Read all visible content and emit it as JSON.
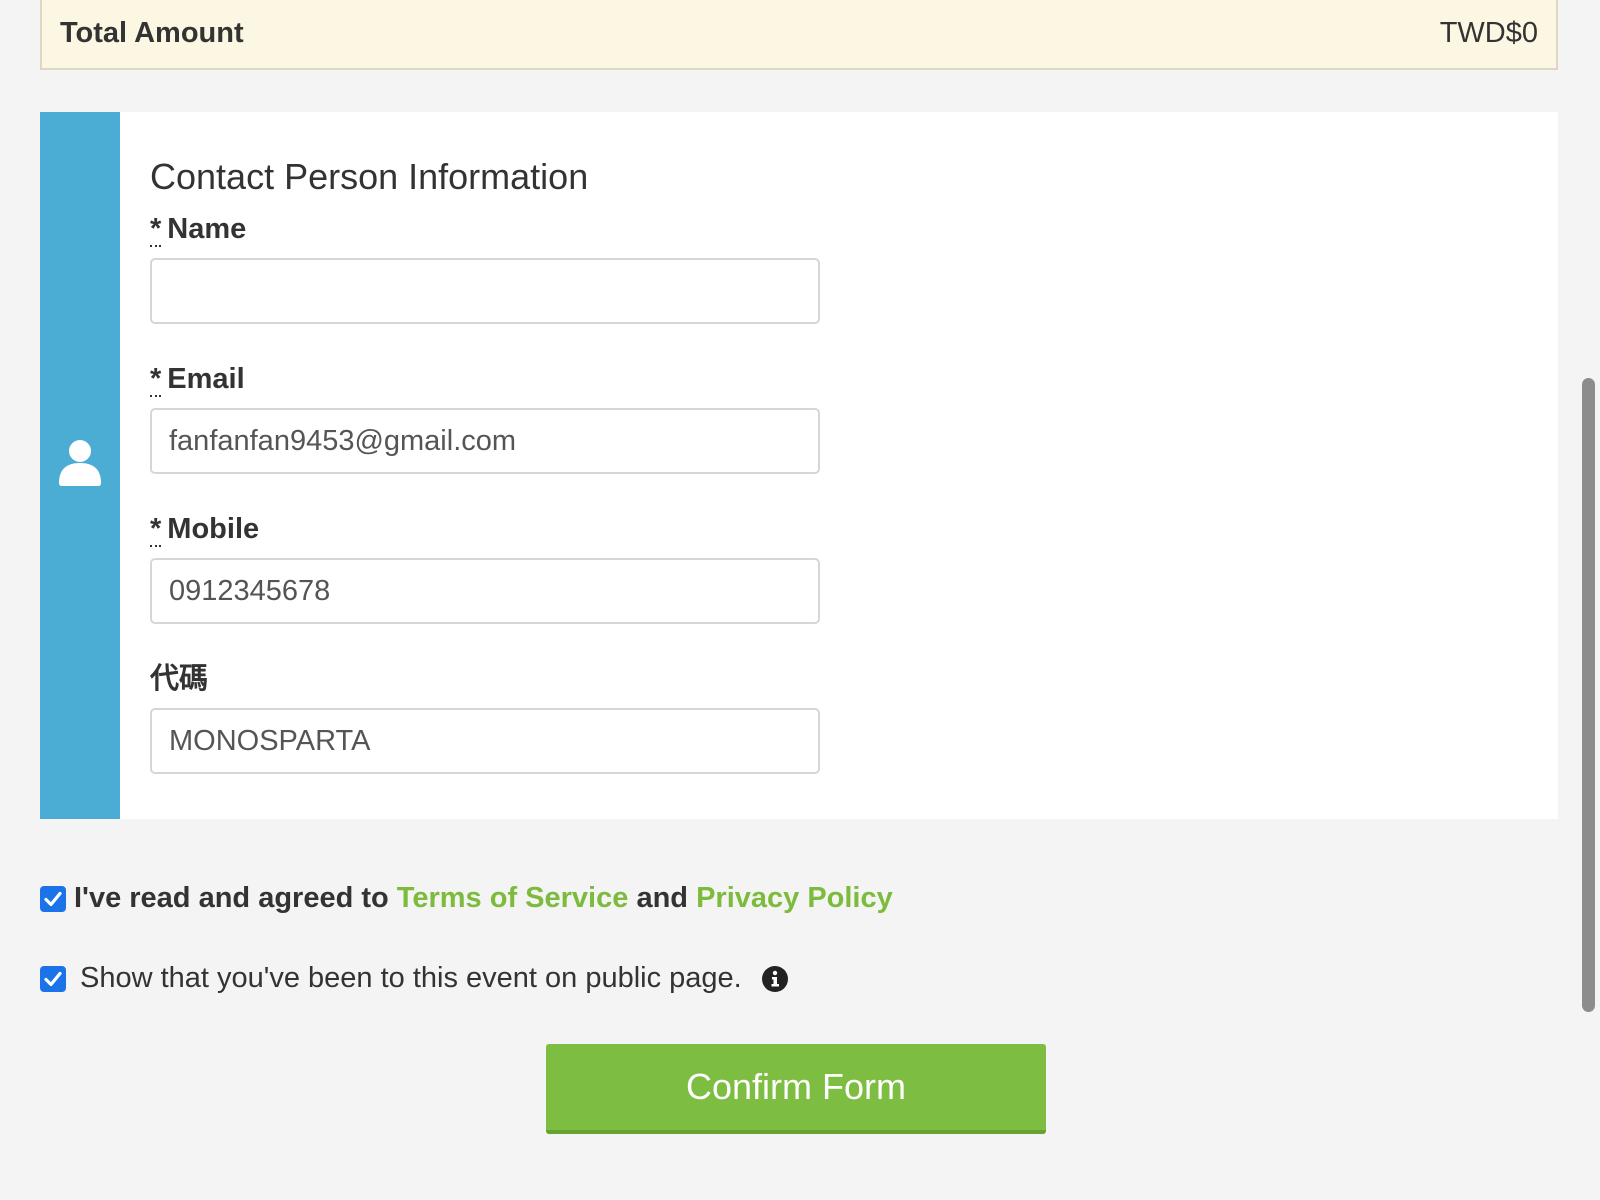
{
  "summary": {
    "total_label": "Total Amount",
    "total_value": "TWD$0"
  },
  "contact": {
    "icon": "user-icon",
    "title": "Contact Person Information",
    "required_marker": "*",
    "fields": {
      "name": {
        "label": "Name",
        "value": ""
      },
      "email": {
        "label": "Email",
        "value": "fanfanfan9453@gmail.com"
      },
      "mobile": {
        "label": "Mobile",
        "value": "0912345678"
      },
      "code": {
        "label": "代碼",
        "value": "MONOSPARTA"
      }
    }
  },
  "agreement": {
    "checked": true,
    "prefix": "I've read and agreed to",
    "terms_link": "Terms of Service",
    "conjunction": "and",
    "privacy_link": "Privacy Policy"
  },
  "public_page": {
    "checked": true,
    "text": "Show that you've been to this event on public page.",
    "icon": "info-icon"
  },
  "actions": {
    "confirm_label": "Confirm Form"
  },
  "colors": {
    "accent_green": "#7dbd42",
    "side_blue": "#4bacd4",
    "summary_bg": "#fcf7e3",
    "checkbox_blue": "#1a73e8"
  }
}
